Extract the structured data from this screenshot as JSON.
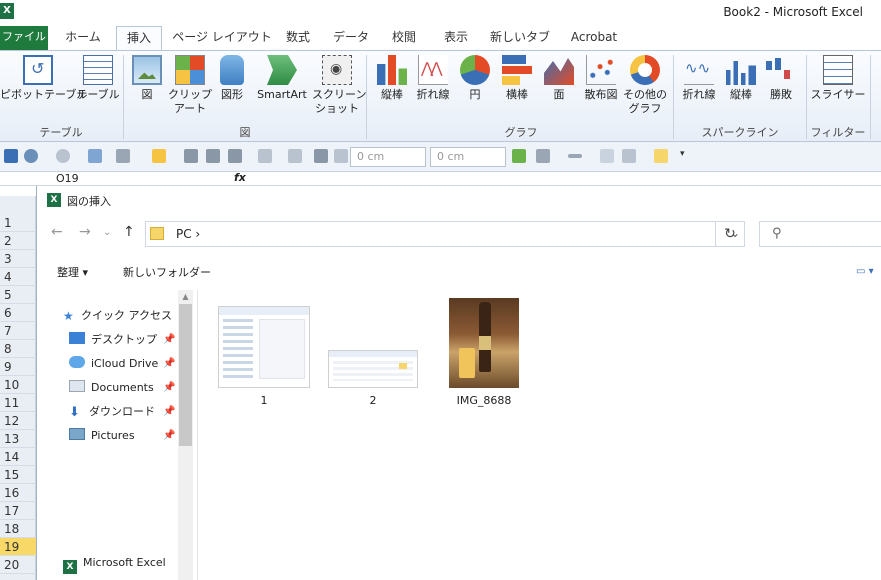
{
  "window": {
    "title": "Book2  -  Microsoft Excel",
    "app_icon": "X"
  },
  "tabs": [
    "ファイル",
    "ホーム",
    "挿入",
    "ページ レイアウト",
    "数式",
    "データ",
    "校閲",
    "表示",
    "新しいタブ",
    "Acrobat"
  ],
  "ribbon": {
    "table_group": {
      "label": "テーブル",
      "buttons": [
        "ピボットテーブル",
        "テーブル"
      ]
    },
    "figure_group": {
      "label": "図",
      "buttons": [
        "図",
        "クリップ",
        "アート",
        "図形",
        "SmartArt",
        "スクリーン",
        "ショット"
      ]
    },
    "graph_group": {
      "label": "グラフ",
      "buttons": [
        "縦棒",
        "折れ線",
        "円",
        "横棒",
        "面",
        "散布図",
        "その他の",
        "グラフ"
      ]
    },
    "sparkline_group": {
      "label": "スパークライン",
      "buttons": [
        "折れ線",
        "縦棒",
        "勝敗"
      ]
    },
    "filter_group": {
      "label": "フィルター",
      "buttons": [
        "スライサー"
      ]
    }
  },
  "quick_toolbar": {
    "field1": "0 cm",
    "field2": "0 cm"
  },
  "formula_bar": {
    "name_box": "O19",
    "fx": "fx"
  },
  "rows": [
    "1",
    "2",
    "3",
    "4",
    "5",
    "6",
    "7",
    "8",
    "9",
    "10",
    "11",
    "12",
    "13",
    "14",
    "15",
    "16",
    "17",
    "18",
    "19",
    "20"
  ],
  "selected_row": "19",
  "dialog": {
    "title": "図の挿入",
    "icon": "X",
    "breadcrumb": "PC  ›",
    "organize": "整理 ▾",
    "new_folder": "新しいフォルダー",
    "nav_items": [
      {
        "label": "クイック アクセス",
        "pinned": false
      },
      {
        "label": "デスクトップ",
        "pinned": true
      },
      {
        "label": "iCloud Drive",
        "pinned": true
      },
      {
        "label": "Documents",
        "pinned": true
      },
      {
        "label": "ダウンロード",
        "pinned": true
      },
      {
        "label": "Pictures",
        "pinned": true
      }
    ],
    "bottom_item": "Microsoft Excel",
    "files": [
      {
        "name": "1"
      },
      {
        "name": "2"
      },
      {
        "name": "IMG_8688"
      }
    ]
  },
  "colors": {
    "file_tab": "#1f7a3d",
    "excel_green": "#1e7145",
    "selected_row": "#f8d866"
  }
}
